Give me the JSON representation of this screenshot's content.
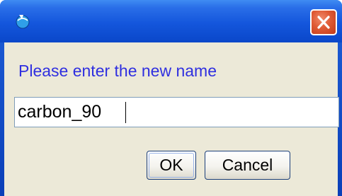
{
  "dialog": {
    "prompt": "Please enter the new name",
    "input_value": "carbon_90"
  },
  "buttons": {
    "ok_label": "OK",
    "cancel_label": "Cancel"
  },
  "icons": {
    "app": "java-app-icon",
    "close": "close-icon"
  },
  "colors": {
    "title_bar": "#0a47c9",
    "close_button": "#df5a35",
    "dialog_background": "#ece9d8",
    "prompt_text": "#2f2fe0"
  }
}
